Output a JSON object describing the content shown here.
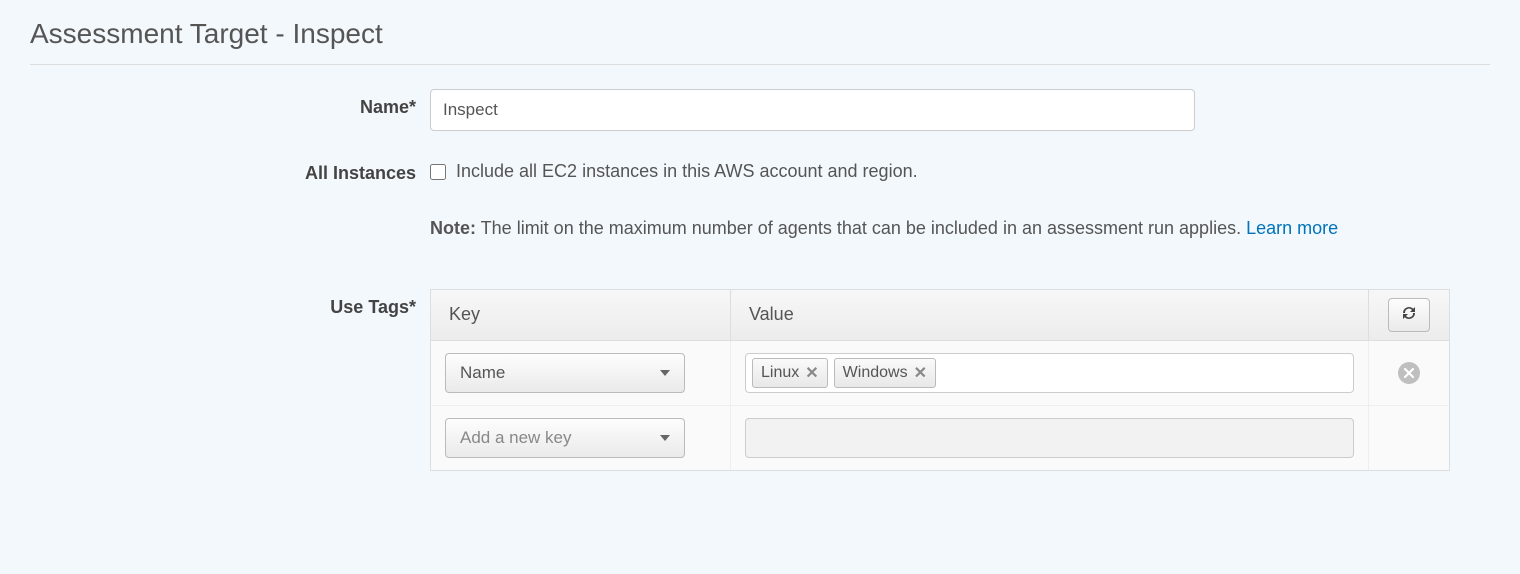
{
  "page": {
    "title": "Assessment Target - Inspect"
  },
  "form": {
    "name": {
      "label": "Name*",
      "value": "Inspect"
    },
    "allInstances": {
      "label": "All Instances",
      "checkboxLabel": "Include all EC2 instances in this AWS account and region.",
      "noteBold": "Note:",
      "noteText": " The limit on the maximum number of agents that can be included in an assessment run applies. ",
      "learnMore": "Learn more"
    },
    "useTags": {
      "label": "Use Tags*",
      "headers": {
        "key": "Key",
        "value": "Value"
      },
      "rows": [
        {
          "keySelected": "Name",
          "values": [
            "Linux",
            "Windows"
          ],
          "removable": true,
          "placeholderKey": null,
          "disabledValue": false
        },
        {
          "keySelected": null,
          "values": [],
          "removable": false,
          "placeholderKey": "Add a new key",
          "disabledValue": true
        }
      ]
    }
  }
}
